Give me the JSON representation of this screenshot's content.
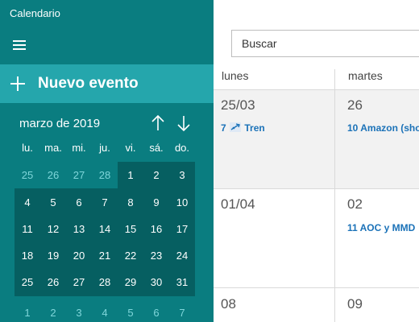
{
  "sidebar": {
    "app_title": "Calendario",
    "new_event_label": "Nuevo evento",
    "month_label": "marzo de 2019",
    "days_of_week": [
      "lu.",
      "ma.",
      "mi.",
      "ju.",
      "vi.",
      "sá.",
      "do."
    ],
    "weeks": [
      [
        "25",
        "26",
        "27",
        "28",
        "1",
        "2",
        "3"
      ],
      [
        "4",
        "5",
        "6",
        "7",
        "8",
        "9",
        "10"
      ],
      [
        "11",
        "12",
        "13",
        "14",
        "15",
        "16",
        "17"
      ],
      [
        "18",
        "19",
        "20",
        "21",
        "22",
        "23",
        "24"
      ],
      [
        "25",
        "26",
        "27",
        "28",
        "29",
        "30",
        "31"
      ],
      [
        "1",
        "2",
        "3",
        "4",
        "5",
        "6",
        "7"
      ]
    ]
  },
  "main": {
    "search_placeholder": "Buscar",
    "columns": [
      "lunes",
      "martes"
    ],
    "rows": [
      {
        "dates": [
          "25/03",
          "26"
        ]
      },
      {
        "dates": [
          "01/04",
          "02"
        ]
      },
      {
        "dates": [
          "08",
          "09"
        ]
      }
    ],
    "events": {
      "e1_time": "7",
      "e1_title": "Tren",
      "e2": "10 Amazon (sho",
      "e3": "11  AOC y MMD"
    }
  },
  "colors": {
    "sidebar": "#0a7d80",
    "new_event_bar": "#25a6ac",
    "month_highlight": "#065f61",
    "event_text": "#1b72b8"
  }
}
